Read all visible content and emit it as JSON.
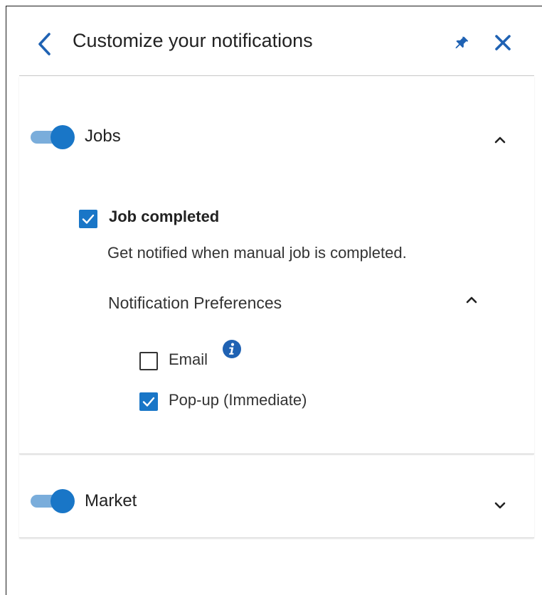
{
  "header": {
    "title": "Customize your notifications",
    "back_icon": "chevron-left-icon",
    "pin_icon": "pin-icon",
    "close_icon": "close-icon"
  },
  "sections": [
    {
      "label": "Jobs",
      "enabled": true,
      "expanded": true,
      "items": [
        {
          "title": "Job completed",
          "checked": true,
          "description": "Get notified when manual job is completed.",
          "preferences": {
            "title": "Notification Preferences",
            "expanded": true,
            "options": [
              {
                "label": "Email",
                "checked": false,
                "info_icon": "info-icon"
              },
              {
                "label": "Pop-up (Immediate)",
                "checked": true
              }
            ]
          }
        }
      ]
    },
    {
      "label": "Market",
      "enabled": true,
      "expanded": false
    }
  ],
  "colors": {
    "accent": "#1976c7",
    "toggle_track": "#7aaddb",
    "header_text": "#222222",
    "divider": "#c9c9c9"
  }
}
